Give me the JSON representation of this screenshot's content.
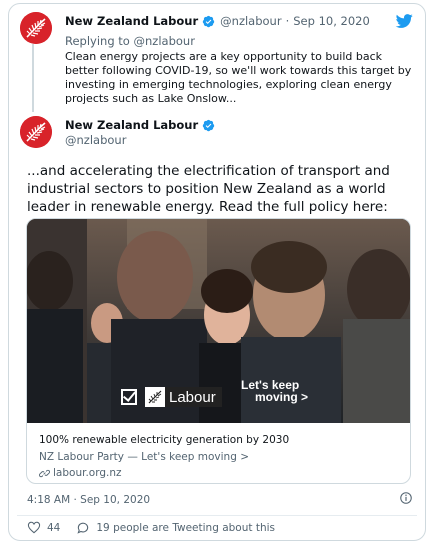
{
  "reply_tweet": {
    "author_name": "New Zealand Labour",
    "handle": "@nzlabour",
    "separator": "·",
    "date": "Sep 10, 2020",
    "replying_prefix": "Replying to",
    "replying_to": "@nzlabour",
    "text": "Clean energy projects are a key opportunity to build back better following COVID-19, so we'll work towards this target by investing in emerging technologies, exploring clean energy projects such as Lake Onslow..."
  },
  "main_tweet": {
    "author_name": "New Zealand Labour",
    "handle": "@nzlabour",
    "text": "...and accelerating the electrification of transport and industrial sectors to position New Zealand as a world leader in renewable energy. Read the full policy here:",
    "timestamp": "4:18 AM · Sep 10, 2020"
  },
  "link_card": {
    "image_badge_text": "Labour",
    "image_slogan_line1": "Let's keep",
    "image_slogan_line2": "moving >",
    "title": "100% renewable electricity generation by 2030",
    "description": "NZ Labour Party — Let's keep moving >",
    "domain": "labour.org.nz"
  },
  "actions": {
    "like_count": "44",
    "tweeting_text": "19 people are Tweeting about this"
  },
  "colors": {
    "brand_red": "#d8232a",
    "twitter_blue": "#1d9bf0",
    "text_secondary": "#536471"
  },
  "icons": [
    "labour-fern-icon",
    "verified-icon",
    "twitter-bird-icon",
    "link-icon",
    "info-icon",
    "heart-icon",
    "speech-bubble-icon"
  ]
}
